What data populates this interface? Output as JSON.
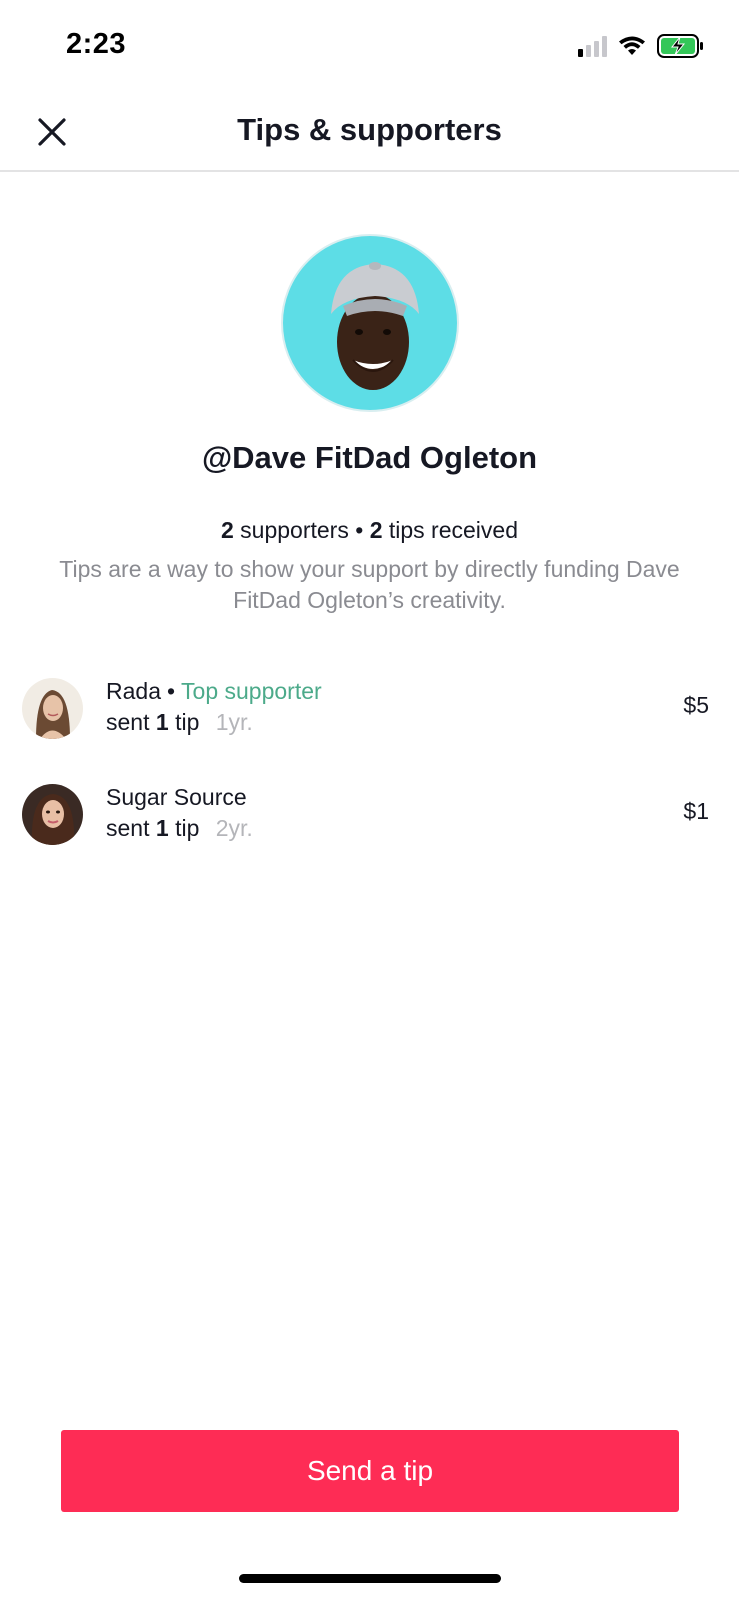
{
  "status_bar": {
    "time": "2:23",
    "icons": [
      "cellular-signal-icon",
      "wifi-icon",
      "battery-charging-icon"
    ],
    "battery_color": "#34c759"
  },
  "nav": {
    "title": "Tips & supporters",
    "close_icon": "close-icon"
  },
  "profile": {
    "username": "@Dave FitDad Ogleton",
    "avatar_bg": "#5ddde6",
    "supporters_count": "2",
    "supporters_label": "supporters",
    "separator": "•",
    "tips_count": "2",
    "tips_label": "tips received",
    "description": "Tips are a way to show your support by directly funding Dave FitDad Ogleton’s creativity."
  },
  "supporters": [
    {
      "name": "Rada",
      "separator": "•",
      "badge": "Top supporter",
      "sent_prefix": "sent",
      "tip_count": "1",
      "tip_word": "tip",
      "time": "1yr.",
      "amount": "$5"
    },
    {
      "name": "Sugar Source",
      "separator": "",
      "badge": "",
      "sent_prefix": "sent",
      "tip_count": "1",
      "tip_word": "tip",
      "time": "2yr.",
      "amount": "$1"
    }
  ],
  "cta": {
    "label": "Send a tip",
    "color": "#fe2c55"
  }
}
